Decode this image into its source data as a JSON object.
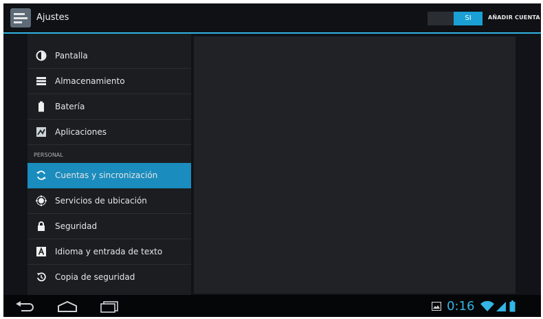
{
  "action_bar": {
    "title": "Ajustes",
    "toggle_label": "SI",
    "add_account": "AÑADIR CUENTA"
  },
  "sidebar": {
    "items_top": [
      {
        "label": "Pantalla",
        "icon": "brightness-icon"
      },
      {
        "label": "Almacenamiento",
        "icon": "storage-icon"
      },
      {
        "label": "Batería",
        "icon": "battery-icon"
      },
      {
        "label": "Aplicaciones",
        "icon": "apps-icon"
      }
    ],
    "section_header": "PERSONAL",
    "items_personal": [
      {
        "label": "Cuentas y sincronización",
        "icon": "sync-icon",
        "selected": true
      },
      {
        "label": "Servicios de ubicación",
        "icon": "location-icon"
      },
      {
        "label": "Seguridad",
        "icon": "lock-icon"
      },
      {
        "label": "Idioma y entrada de texto",
        "icon": "language-icon"
      },
      {
        "label": "Copia de seguridad",
        "icon": "backup-icon"
      }
    ]
  },
  "status_bar": {
    "time": "0:16",
    "icons": [
      "gallery-notification-icon",
      "wifi-icon",
      "signal-icon",
      "battery-icon"
    ]
  },
  "nav_bar": {
    "buttons": [
      "back-icon",
      "home-icon",
      "recent-apps-icon"
    ]
  },
  "colors": {
    "accent": "#33b5e5",
    "selected_item": "#1a8cbd",
    "background": "#111318"
  }
}
